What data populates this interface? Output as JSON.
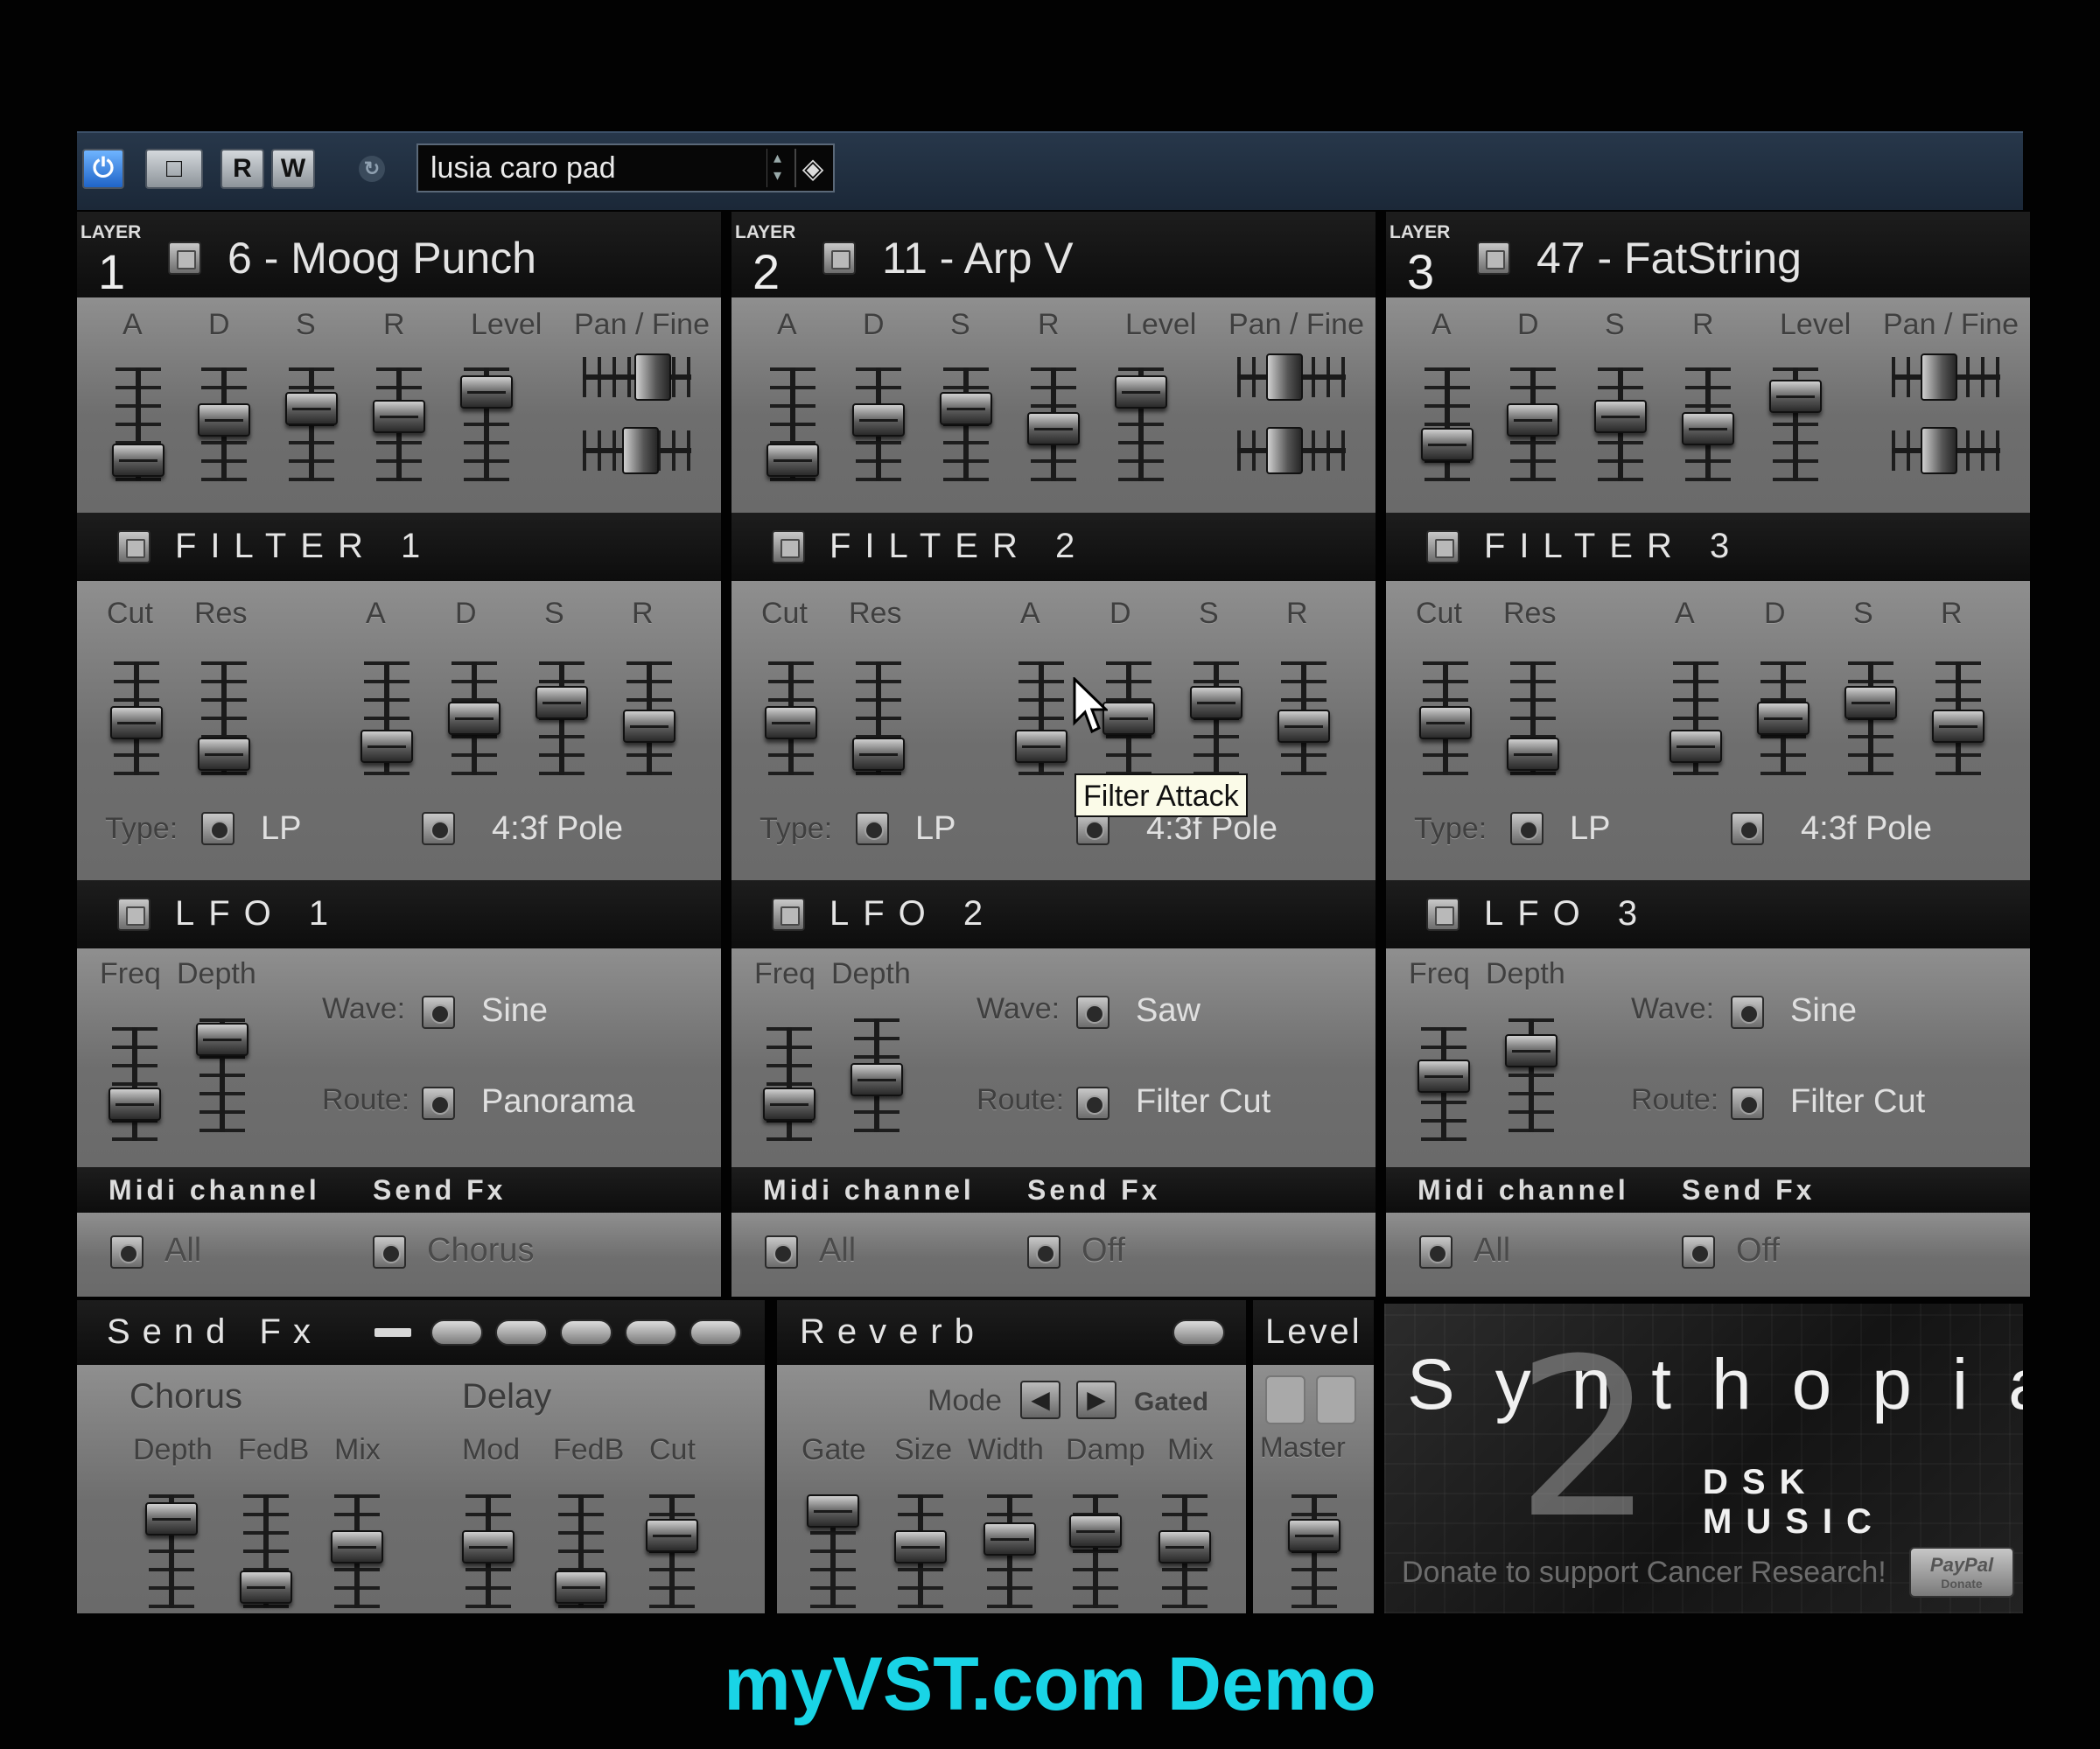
{
  "toolbar": {
    "power_icon": "power-icon",
    "edit_label": "□",
    "read_label": "R",
    "write_label": "W",
    "sync_icon": "sync-icon",
    "preset_name": "lusia caro pad"
  },
  "layers": [
    {
      "layer_word": "LAYER",
      "number": "1",
      "patch": "6 - Moog Punch",
      "env_labels": [
        "A",
        "D",
        "S",
        "R",
        "Level",
        "Pan / Fine"
      ],
      "filter_title": "FILTER 1",
      "filter_labels": [
        "Cut",
        "Res",
        "A",
        "D",
        "S",
        "R"
      ],
      "type_label": "Type:",
      "filter_type": "LP",
      "filter_pole": "4:3f Pole",
      "lfo_title": "LFO 1",
      "lfo_labels": [
        "Freq",
        "Depth"
      ],
      "wave_label": "Wave:",
      "wave": "Sine",
      "route_label": "Route:",
      "route": "Panorama",
      "midi_label": "Midi channel",
      "sendfx_label": "Send Fx",
      "midi_value": "All",
      "sendfx_value": "Chorus"
    },
    {
      "layer_word": "LAYER",
      "number": "2",
      "patch": "11 - Arp V",
      "env_labels": [
        "A",
        "D",
        "S",
        "R",
        "Level",
        "Pan / Fine"
      ],
      "filter_title": "FILTER 2",
      "filter_labels": [
        "Cut",
        "Res",
        "A",
        "D",
        "S",
        "R"
      ],
      "type_label": "Type:",
      "filter_type": "LP",
      "filter_pole": "4:3f Pole",
      "lfo_title": "LFO 2",
      "lfo_labels": [
        "Freq",
        "Depth"
      ],
      "wave_label": "Wave:",
      "wave": "Saw",
      "route_label": "Route:",
      "route": "Filter Cut",
      "midi_label": "Midi channel",
      "sendfx_label": "Send Fx",
      "midi_value": "All",
      "sendfx_value": "Off"
    },
    {
      "layer_word": "LAYER",
      "number": "3",
      "patch": "47 - FatString",
      "env_labels": [
        "A",
        "D",
        "S",
        "R",
        "Level",
        "Pan / Fine"
      ],
      "filter_title": "FILTER 3",
      "filter_labels": [
        "Cut",
        "Res",
        "A",
        "D",
        "S",
        "R"
      ],
      "type_label": "Type:",
      "filter_type": "LP",
      "filter_pole": "4:3f Pole",
      "lfo_title": "LFO 3",
      "lfo_labels": [
        "Freq",
        "Depth"
      ],
      "wave_label": "Wave:",
      "wave": "Sine",
      "route_label": "Route:",
      "route": "Filter Cut",
      "midi_label": "Midi channel",
      "sendfx_label": "Send Fx",
      "midi_value": "All",
      "sendfx_value": "Off"
    }
  ],
  "fx": {
    "send_title": "Send Fx",
    "chorus_title": "Chorus",
    "chorus_labels": [
      "Depth",
      "FedB",
      "Mix"
    ],
    "delay_title": "Delay",
    "delay_labels": [
      "Mod",
      "FedB",
      "Cut"
    ],
    "reverb_title": "Reverb",
    "mode_label": "Mode",
    "mode_value": "Gated",
    "reverb_labels": [
      "Gate",
      "Size",
      "Width",
      "Damp",
      "Mix"
    ],
    "level_title": "Level",
    "master_label": "Master"
  },
  "logo": {
    "title": "Synthopia",
    "numeral": "2",
    "subtitle": "DSK MUSIC",
    "donate": "Donate to support Cancer Research!",
    "paypal": "PayPal",
    "paypal_sub": "Donate"
  },
  "tooltip": "Filter Attack",
  "caption": "myVST.com Demo",
  "colors": {
    "caption": "#19d4e6",
    "toolbar": "#1f2d3d",
    "panel": "#7a7a7a",
    "band": "#111111"
  }
}
